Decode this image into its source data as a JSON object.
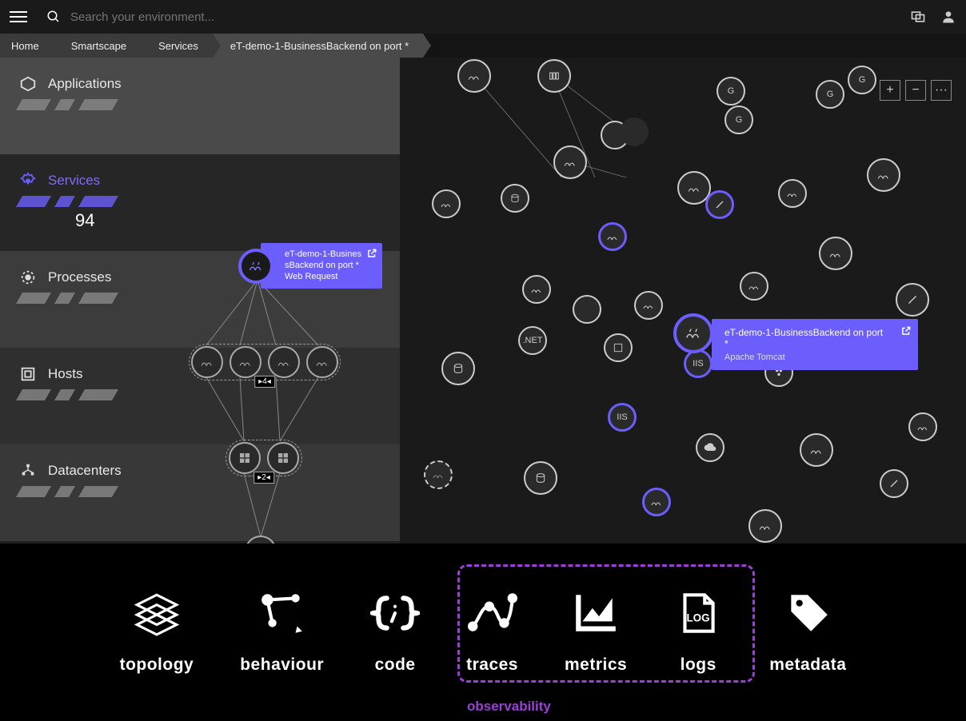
{
  "topbar": {
    "search_placeholder": "Search your environment..."
  },
  "breadcrumb": {
    "items": [
      "Home",
      "Smartscape",
      "Services",
      "eT-demo-1-BusinessBackend on port *"
    ]
  },
  "layers": {
    "applications": {
      "label": "Applications"
    },
    "services": {
      "label": "Services",
      "count": "94"
    },
    "processes": {
      "label": "Processes"
    },
    "hosts": {
      "label": "Hosts"
    },
    "datacenters": {
      "label": "Datacenters"
    }
  },
  "sidebar_chip": {
    "line1": "eT-demo-1-Busines",
    "line2": "sBackend on port *",
    "line3": "Web Request"
  },
  "hierarchy": {
    "processes_badge": "▸4◂",
    "hosts_badge": "▸2◂"
  },
  "graph": {
    "zoom_in": "+",
    "zoom_out": "−",
    "more": "···"
  },
  "tooltip": {
    "title": "eT-demo-1-BusinessBackend on port *",
    "subtitle": "Apache Tomcat"
  },
  "bottom": {
    "items": [
      "topology",
      "behaviour",
      "code",
      "traces",
      "metrics",
      "logs",
      "metadata"
    ],
    "observability_label": "observability"
  },
  "node_labels": {
    "iis": "IIS",
    "net": ".NET"
  }
}
